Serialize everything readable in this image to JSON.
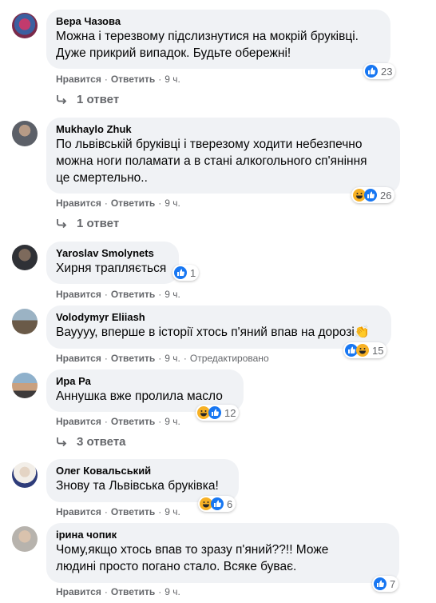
{
  "comments": [
    {
      "author": "Вера Чазова",
      "lines": [
        "Можна і терезвому підслизнутися на мокрій бруківці.",
        "Дуже прикрий випадок. Будьте обережні!"
      ],
      "reactions": [
        "like"
      ],
      "reaction_count": "23",
      "like_label": "Нравится",
      "reply_label": "Ответить",
      "time": "9 ч.",
      "replies_label": "1 ответ"
    },
    {
      "author": "Mukhaylo Zhuk",
      "lines": [
        "По львівській бруківці і тверезому ходити небезпечно",
        "можна ноги поламати а в стані алкогольного сп'яніння",
        "це смертельно.."
      ],
      "reactions": [
        "haha",
        "like"
      ],
      "reaction_count": "26",
      "like_label": "Нравится",
      "reply_label": "Ответить",
      "time": "9 ч.",
      "replies_label": "1 ответ"
    },
    {
      "author": "Yaroslav Smolynets",
      "lines": [
        "Хирня трапляється"
      ],
      "reactions": [
        "like"
      ],
      "reaction_count": "1",
      "like_label": "Нравится",
      "reply_label": "Ответить",
      "time": "9 ч."
    },
    {
      "author": "Volodymyr Eliiash",
      "lines": [
        "Вауууу, вперше в історії хтось п'яний впав на дорозі👏"
      ],
      "reactions": [
        "like",
        "haha"
      ],
      "reaction_count": "15",
      "like_label": "Нравится",
      "reply_label": "Ответить",
      "time": "9 ч.",
      "edited_label": "Отредактировано"
    },
    {
      "author": "Ира Ра",
      "lines": [
        "Аннушка вже пролила масло"
      ],
      "reactions": [
        "haha",
        "like"
      ],
      "reaction_count": "12",
      "like_label": "Нравится",
      "reply_label": "Ответить",
      "time": "9 ч.",
      "replies_label": "3 ответа"
    },
    {
      "author": "Олег Ковальський",
      "lines": [
        "Знову та Львівська бруківка!"
      ],
      "reactions": [
        "haha",
        "like"
      ],
      "reaction_count": "6",
      "like_label": "Нравится",
      "reply_label": "Ответить",
      "time": "9 ч."
    },
    {
      "author": "ірина чопик",
      "lines": [
        "Чому,якщо хтось впав то зразу п'яний??!! Може",
        "людині просто погано стало. Всяке буває."
      ],
      "reactions": [
        "like"
      ],
      "reaction_count": "7",
      "like_label": "Нравится",
      "reply_label": "Ответить",
      "time": "9 ч."
    }
  ],
  "colors": {
    "bubble": "#f0f2f5",
    "like": "#1877f2",
    "haha": "#f7b125",
    "meta": "#65676b"
  }
}
